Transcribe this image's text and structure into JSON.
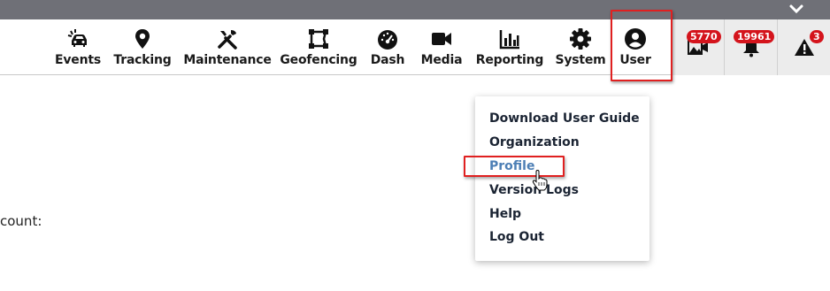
{
  "nav": {
    "items": [
      {
        "id": "events",
        "label": "Events",
        "icon": "car-crash-icon"
      },
      {
        "id": "tracking",
        "label": "Tracking",
        "icon": "map-pin-icon"
      },
      {
        "id": "maintenance",
        "label": "Maintenance",
        "icon": "tools-icon"
      },
      {
        "id": "geofencing",
        "label": "Geofencing",
        "icon": "geofence-icon"
      },
      {
        "id": "dash",
        "label": "Dash",
        "icon": "speedometer-icon"
      },
      {
        "id": "media",
        "label": "Media",
        "icon": "video-camera-icon"
      },
      {
        "id": "reporting",
        "label": "Reporting",
        "icon": "bar-chart-icon"
      },
      {
        "id": "system",
        "label": "System",
        "icon": "gear-icon"
      },
      {
        "id": "user",
        "label": "User",
        "icon": "user-circle-icon"
      }
    ],
    "badges": {
      "media": "5770",
      "alerts": "19961",
      "warnings": "3"
    }
  },
  "user_menu": {
    "items": [
      "Download User Guide",
      "Organization",
      "Profile",
      "Version Logs",
      "Help",
      "Log Out"
    ],
    "active": "Profile"
  },
  "page": {
    "partial_text": "count:"
  },
  "colors": {
    "topbar": "#6f7077",
    "highlight": "#e02020",
    "badge": "#d4141c",
    "active_menu": "#4d7fb5"
  }
}
